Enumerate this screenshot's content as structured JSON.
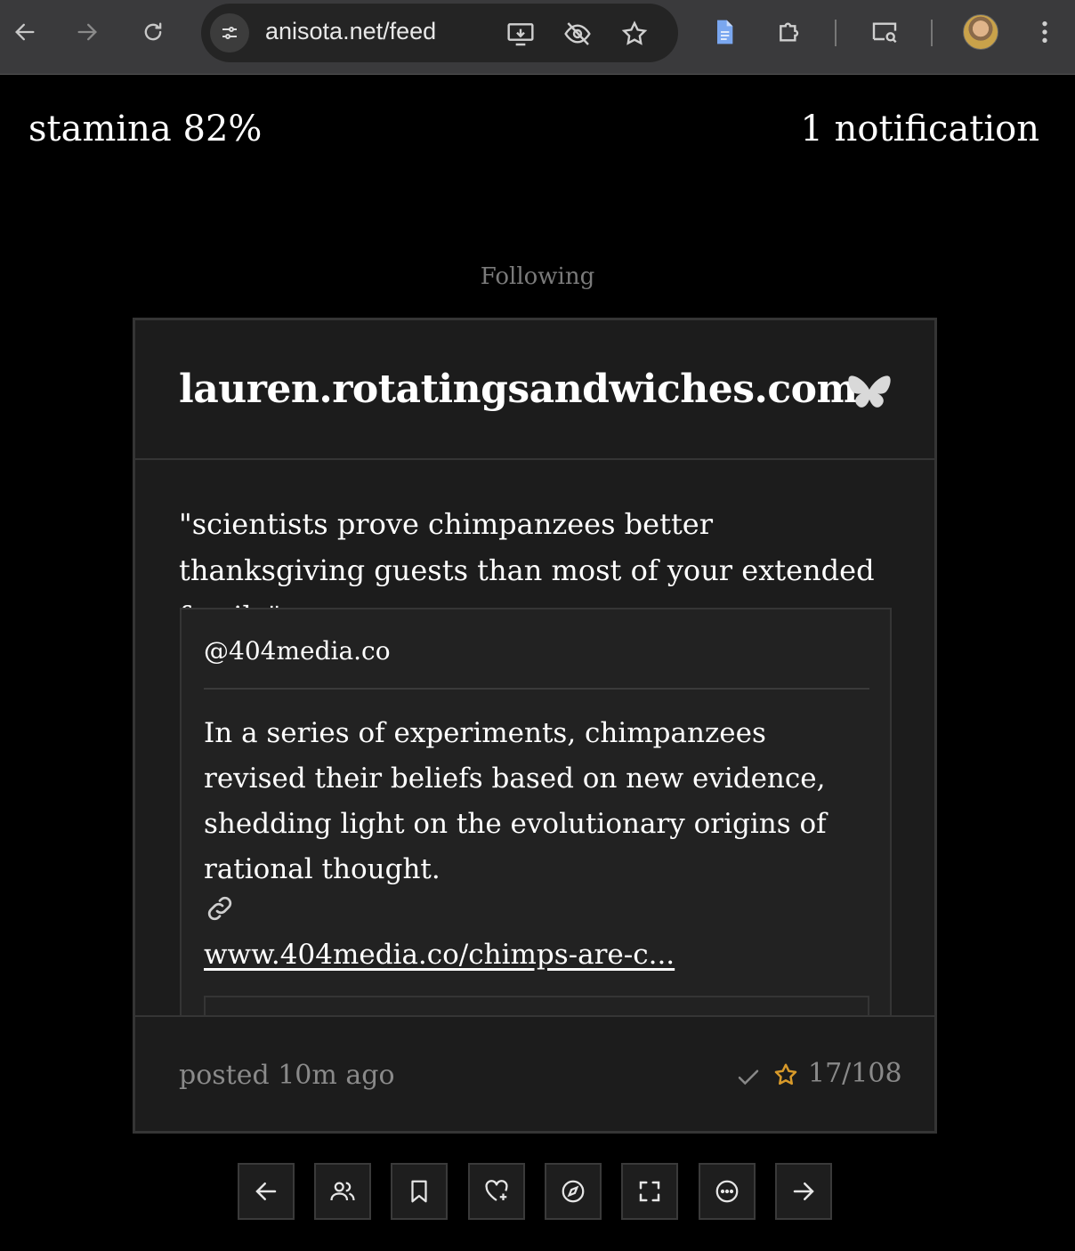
{
  "browser": {
    "url": "anisota.net/feed"
  },
  "header": {
    "stamina": "stamina 82%",
    "notifications": "1 notification"
  },
  "feed": {
    "tab_label": "Following"
  },
  "post": {
    "author": "lauren.rotatingsandwiches.com",
    "text": "\"scientists prove chimpanzees better thanksgiving guests than most of your extended family\"",
    "quote": {
      "handle": "@404media.co",
      "text": "In a series of experiments, chimpanzees revised their beliefs based on new evidence, shedding light on the evolutionary origins of rational thought.",
      "link": "www.404media.co/chimps-are-c..."
    },
    "posted": "posted 10m ago",
    "position": "17/108"
  },
  "colors": {
    "star": "#d89a2a",
    "card_bg": "#1c1c1c",
    "border": "#353535"
  }
}
